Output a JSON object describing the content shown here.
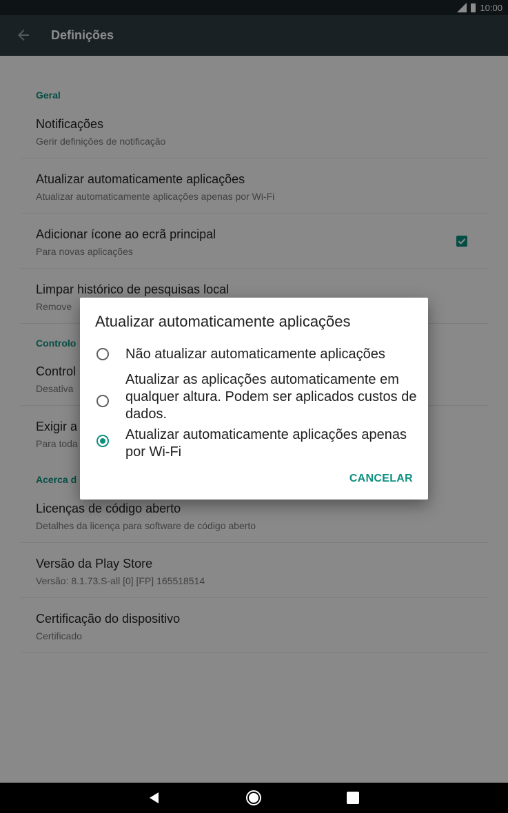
{
  "status_bar": {
    "time": "10:00",
    "icons": [
      "signal-icon",
      "battery-icon"
    ]
  },
  "app_bar": {
    "title": "Definições",
    "back_icon": "arrow-left-icon"
  },
  "sections": {
    "general": "Geral",
    "controls": "Controlo",
    "about": "Acerca d"
  },
  "prefs": {
    "notifications": {
      "title": "Notificações",
      "subtitle": "Gerir definições de notificação"
    },
    "auto_update": {
      "title": "Atualizar automaticamente aplicações",
      "subtitle": "Atualizar automaticamente aplicações apenas por Wi-Fi"
    },
    "add_icon": {
      "title": "Adicionar ícone ao ecrã principal",
      "subtitle": "Para novas aplicações",
      "checked": true
    },
    "clear_history": {
      "title": "Limpar histórico de pesquisas local",
      "subtitle": "Remove"
    },
    "parental": {
      "title": "Control",
      "subtitle": "Desativa"
    },
    "require_auth": {
      "title": "Exigir a",
      "subtitle": "Para toda"
    },
    "licenses": {
      "title": "Licenças de código aberto",
      "subtitle": "Detalhes da licença para software de código aberto"
    },
    "version": {
      "title": "Versão da Play Store",
      "subtitle": "Versão: 8.1.73.S-all [0] [FP] 165518514"
    },
    "certification": {
      "title": "Certificação do dispositivo",
      "subtitle": "Certificado"
    }
  },
  "dialog": {
    "title": "Atualizar automaticamente aplicações",
    "options": [
      {
        "label": "Não atualizar automaticamente aplicações",
        "selected": false
      },
      {
        "label": "Atualizar as aplicações automaticamente em qualquer altura. Podem ser aplicados custos de dados.",
        "selected": false
      },
      {
        "label": "Atualizar automaticamente aplicações apenas por Wi-Fi",
        "selected": true
      }
    ],
    "cancel_label": "CANCELAR"
  },
  "colors": {
    "accent": "#0b8f7e",
    "app_bar": "#2f3c44",
    "status_bar": "#1b2328"
  },
  "nav_bar": {
    "icons": [
      "nav-back-icon",
      "nav-home-icon",
      "nav-recents-icon"
    ]
  }
}
